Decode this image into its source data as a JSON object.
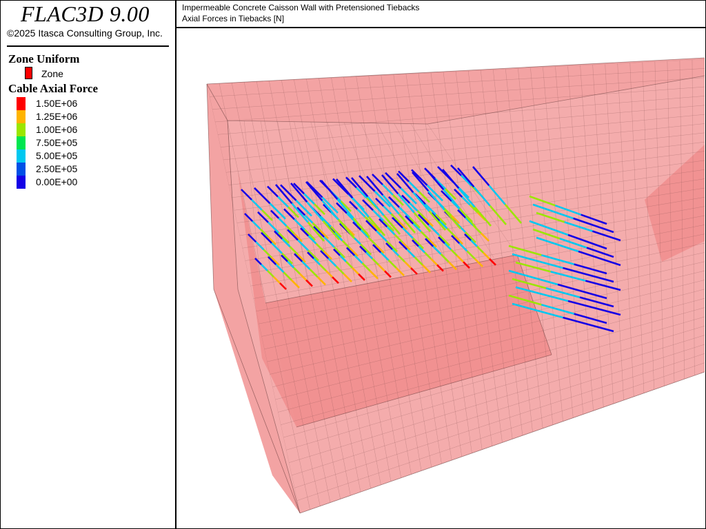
{
  "app": {
    "title": "FLAC3D 9.00",
    "copyright": "©2025 Itasca Consulting Group, Inc."
  },
  "plot": {
    "title": "Impermeable Concrete Caisson Wall with Pretensioned Tiebacks",
    "subtitle": "Axial Forces in Tiebacks [N]"
  },
  "legend": {
    "zone_heading": "Zone Uniform",
    "zone_item_label": "Zone",
    "zone_color": "#ff0000",
    "cable_heading": "Cable Axial Force",
    "ramp": [
      {
        "label": "1.50E+06",
        "color": "#ff0000"
      },
      {
        "label": "1.25E+06",
        "color": "#ffb400"
      },
      {
        "label": "1.00E+06",
        "color": "#9be600"
      },
      {
        "label": "7.50E+05",
        "color": "#00e650"
      },
      {
        "label": "5.00E+05",
        "color": "#00c8f0"
      },
      {
        "label": "2.50E+05",
        "color": "#0050e6"
      },
      {
        "label": "0.00E+00",
        "color": "#1400e6"
      }
    ]
  },
  "scene": {
    "block_color": "#f08c8c",
    "cable_segment_colors": [
      "#1400e6",
      "#00c8f0",
      "#9be600",
      "#ffb400",
      "#ff0000"
    ]
  }
}
